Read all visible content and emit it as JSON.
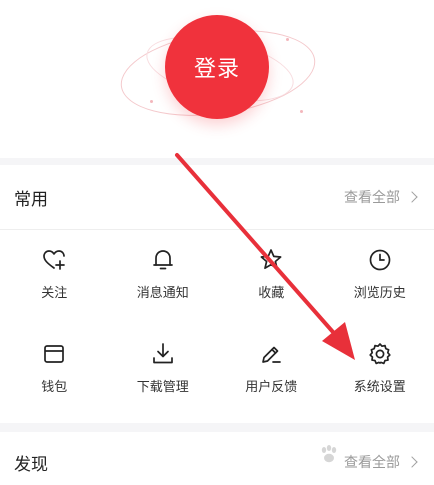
{
  "login": {
    "label": "登录"
  },
  "common": {
    "title": "常用",
    "more": "查看全部",
    "items": [
      {
        "label": "关注",
        "icon": "heart-plus-icon"
      },
      {
        "label": "消息通知",
        "icon": "bell-icon"
      },
      {
        "label": "收藏",
        "icon": "star-icon"
      },
      {
        "label": "浏览历史",
        "icon": "clock-icon"
      },
      {
        "label": "钱包",
        "icon": "wallet-icon"
      },
      {
        "label": "下载管理",
        "icon": "download-icon"
      },
      {
        "label": "用户反馈",
        "icon": "pencil-icon"
      },
      {
        "label": "系统设置",
        "icon": "gear-icon"
      }
    ]
  },
  "discover": {
    "title": "发现",
    "more": "查看全部"
  },
  "colors": {
    "accent": "#f0323c",
    "arrow": "#e8303a"
  }
}
